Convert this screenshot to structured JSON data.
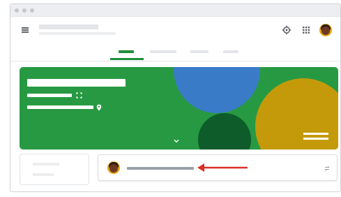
{
  "window": {
    "traffic_lights": [
      "close-dot",
      "minimize-dot",
      "maximize-dot"
    ]
  },
  "appbar": {
    "menu_icon": "hamburger-menu-icon",
    "settings_icon": "gear-icon",
    "apps_icon": "apps-grid-icon",
    "account_icon": "avatar"
  },
  "tabs": {
    "count": 4,
    "active_index": 0
  },
  "banner": {
    "background_color": "#279942",
    "accent_colors": [
      "#3a7bc8",
      "#0d5c2a",
      "#c49a0a"
    ],
    "icons": [
      "fullscreen-icon",
      "location-pin-icon",
      "chevron-down-icon",
      "menu-lines-icon"
    ]
  },
  "stream": {
    "post_icon": "repost-icon",
    "annotation_arrow_color": "#d93025"
  }
}
